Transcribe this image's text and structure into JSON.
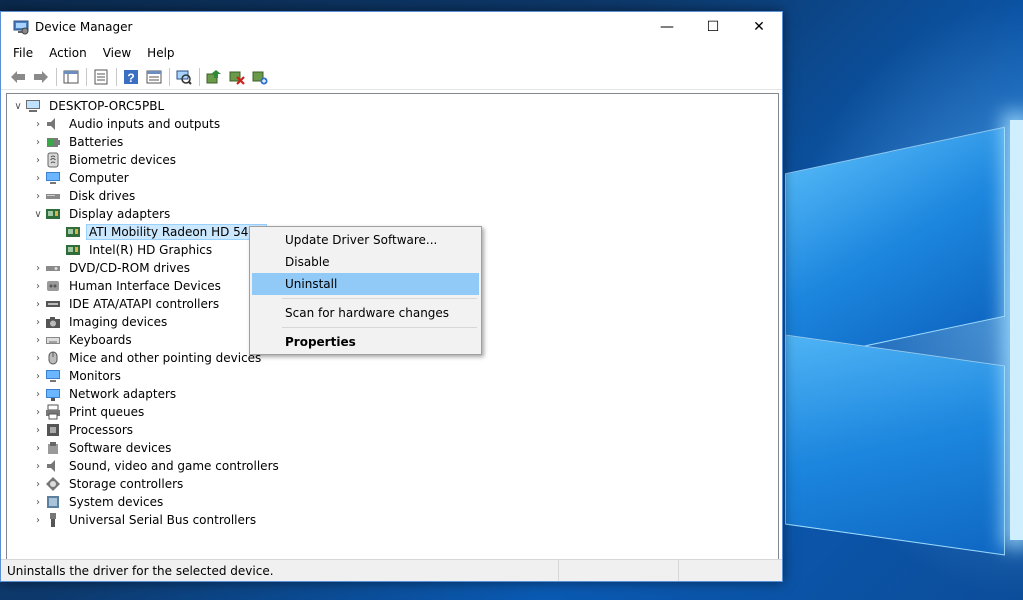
{
  "window": {
    "title": "Device Manager",
    "minimize_glyph": "—",
    "maximize_glyph": "☐",
    "close_glyph": "✕"
  },
  "menu": [
    "File",
    "Action",
    "View",
    "Help"
  ],
  "toolbar": {
    "buttons": [
      "back-icon",
      "forward-icon",
      "show-hide-tree-icon",
      "properties-icon",
      "help-icon",
      "action-view-icon",
      "scan-hardware-icon",
      "update-driver-icon",
      "uninstall-icon",
      "enable-device-icon"
    ]
  },
  "tree": {
    "root": "DESKTOP-ORC5PBL",
    "categories": [
      {
        "label": "Audio inputs and outputs",
        "icon": "speaker-icon"
      },
      {
        "label": "Batteries",
        "icon": "battery-icon"
      },
      {
        "label": "Biometric devices",
        "icon": "fingerprint-icon"
      },
      {
        "label": "Computer",
        "icon": "monitor-icon"
      },
      {
        "label": "Disk drives",
        "icon": "disk-drive-icon"
      },
      {
        "label": "Display adapters",
        "icon": "display-adapter-icon",
        "expanded": true,
        "children": [
          {
            "label": "ATI Mobility Radeon HD 5470",
            "selected": true
          },
          {
            "label": "Intel(R) HD Graphics"
          }
        ]
      },
      {
        "label": "DVD/CD-ROM drives",
        "icon": "dvd-icon"
      },
      {
        "label": "Human Interface Devices",
        "icon": "hid-icon"
      },
      {
        "label": "IDE ATA/ATAPI controllers",
        "icon": "ide-icon"
      },
      {
        "label": "Imaging devices",
        "icon": "camera-icon"
      },
      {
        "label": "Keyboards",
        "icon": "keyboard-icon"
      },
      {
        "label": "Mice and other pointing devices",
        "icon": "mouse-icon"
      },
      {
        "label": "Monitors",
        "icon": "monitor-icon"
      },
      {
        "label": "Network adapters",
        "icon": "network-icon"
      },
      {
        "label": "Print queues",
        "icon": "printer-icon"
      },
      {
        "label": "Processors",
        "icon": "processor-icon"
      },
      {
        "label": "Software devices",
        "icon": "software-device-icon"
      },
      {
        "label": "Sound, video and game controllers",
        "icon": "speaker-icon"
      },
      {
        "label": "Storage controllers",
        "icon": "storage-controller-icon"
      },
      {
        "label": "System devices",
        "icon": "system-device-icon"
      },
      {
        "label": "Universal Serial Bus controllers",
        "icon": "usb-icon"
      }
    ]
  },
  "context_menu": {
    "update": "Update Driver Software...",
    "disable": "Disable",
    "uninstall": "Uninstall",
    "scan": "Scan for hardware changes",
    "properties": "Properties"
  },
  "status": {
    "text": "Uninstalls the driver for the selected device."
  },
  "colors": {
    "selection": "#cce8ff",
    "menu_highlight": "#91c9f7",
    "window_border": "#5b8fd6"
  }
}
